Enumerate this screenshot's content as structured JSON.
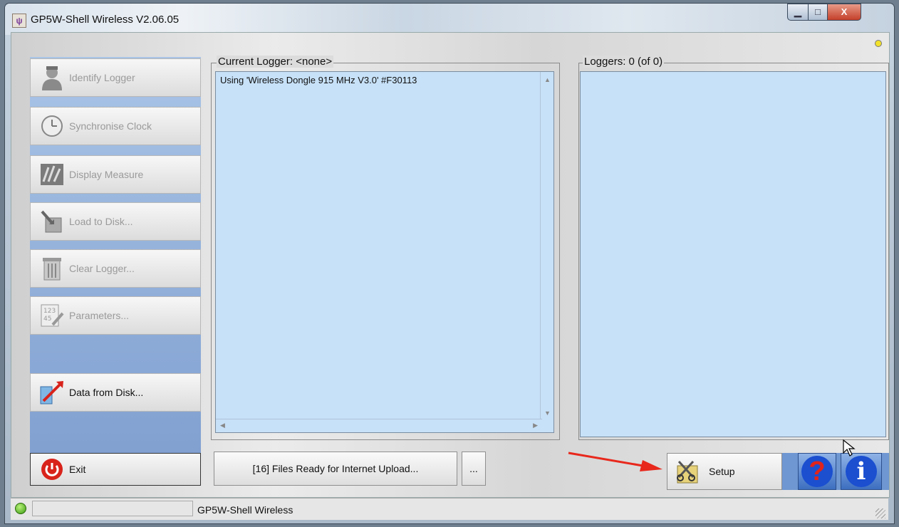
{
  "window": {
    "title": "GP5W-Shell Wireless V2.06.05",
    "minimize_glyph": "▁",
    "maximize_glyph": "□",
    "close_glyph": "X"
  },
  "sidebar": {
    "items": [
      {
        "label": "Identify Logger",
        "icon": "person-icon",
        "enabled": false
      },
      {
        "label": "Synchronise Clock",
        "icon": "clock-icon",
        "enabled": false
      },
      {
        "label": "Display Measure",
        "icon": "measure-icon",
        "enabled": false
      },
      {
        "label": "Load to Disk...",
        "icon": "download-icon",
        "enabled": false
      },
      {
        "label": "Clear Logger...",
        "icon": "trash-icon",
        "enabled": false
      },
      {
        "label": "Parameters...",
        "icon": "parameters-icon",
        "enabled": false
      }
    ],
    "data_from_disk_label": "Data from Disk...",
    "exit_label": "Exit"
  },
  "current_logger": {
    "legend": "Current Logger: <none>",
    "log_line": "Using 'Wireless Dongle 915 MHz V3.0' #F30113"
  },
  "loggers": {
    "legend": "Loggers: 0 (of 0)"
  },
  "footer": {
    "upload_label": "[16] Files Ready for Internet Upload...",
    "more_label": "...",
    "setup_label": "Setup",
    "help_glyph": "?",
    "info_glyph": "i"
  },
  "statusbar": {
    "text": "GP5W-Shell Wireless"
  },
  "colors": {
    "pane_bg": "#c7e1f8",
    "sidebar_bg": "#8fa9d6",
    "exit_red": "#d8231b",
    "help_blue": "#1b4fd0",
    "arrow_red": "#e8281c"
  }
}
